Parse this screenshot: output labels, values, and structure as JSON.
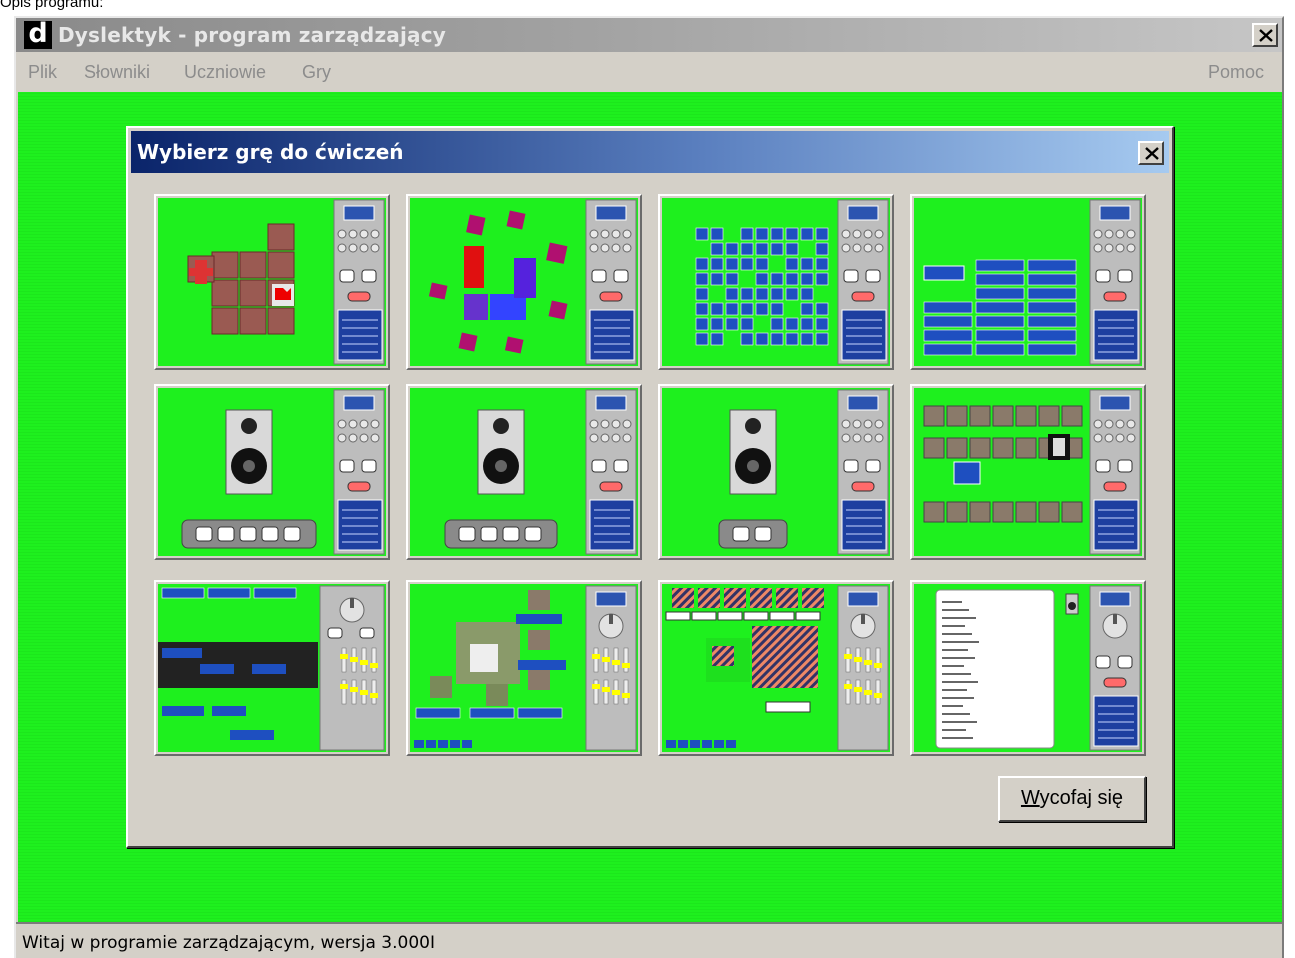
{
  "caption": "Opis programu:",
  "app": {
    "logo_letter": "d",
    "title": "Dyslektyk - program zarządzający",
    "menu": [
      "Plik",
      "Słowniki",
      "Uczniowie",
      "Gry"
    ],
    "help_menu": "Pomoc",
    "status": "Witaj w programie zarządzającym, wersja 3.000I",
    "workspace_color": "#1ef01e"
  },
  "dialog": {
    "title": "Wybierz grę do ćwiczeń",
    "cancel_button": {
      "hotkey": "W",
      "rest": "ycofaj się"
    },
    "games": [
      {
        "id": "memory-tiles",
        "icon": "memory-tiles-thumbnail"
      },
      {
        "id": "shapes-puzzle",
        "icon": "shapes-puzzle-thumbnail"
      },
      {
        "id": "icon-grid",
        "icon": "icon-grid-thumbnail"
      },
      {
        "id": "word-buttons",
        "icon": "word-buttons-thumbnail"
      },
      {
        "id": "speaker-5-buttons",
        "icon": "speaker-thumbnail"
      },
      {
        "id": "speaker-4-buttons",
        "icon": "speaker-thumbnail"
      },
      {
        "id": "speaker-2-buttons",
        "icon": "speaker-thumbnail"
      },
      {
        "id": "speaker-tiles",
        "icon": "speaker-tiles-thumbnail"
      },
      {
        "id": "word-assembly",
        "icon": "word-assembly-thumbnail"
      },
      {
        "id": "picture-puzzle",
        "icon": "picture-puzzle-thumbnail"
      },
      {
        "id": "pattern-match",
        "icon": "pattern-match-thumbnail"
      },
      {
        "id": "word-list",
        "icon": "word-list-thumbnail"
      }
    ]
  }
}
